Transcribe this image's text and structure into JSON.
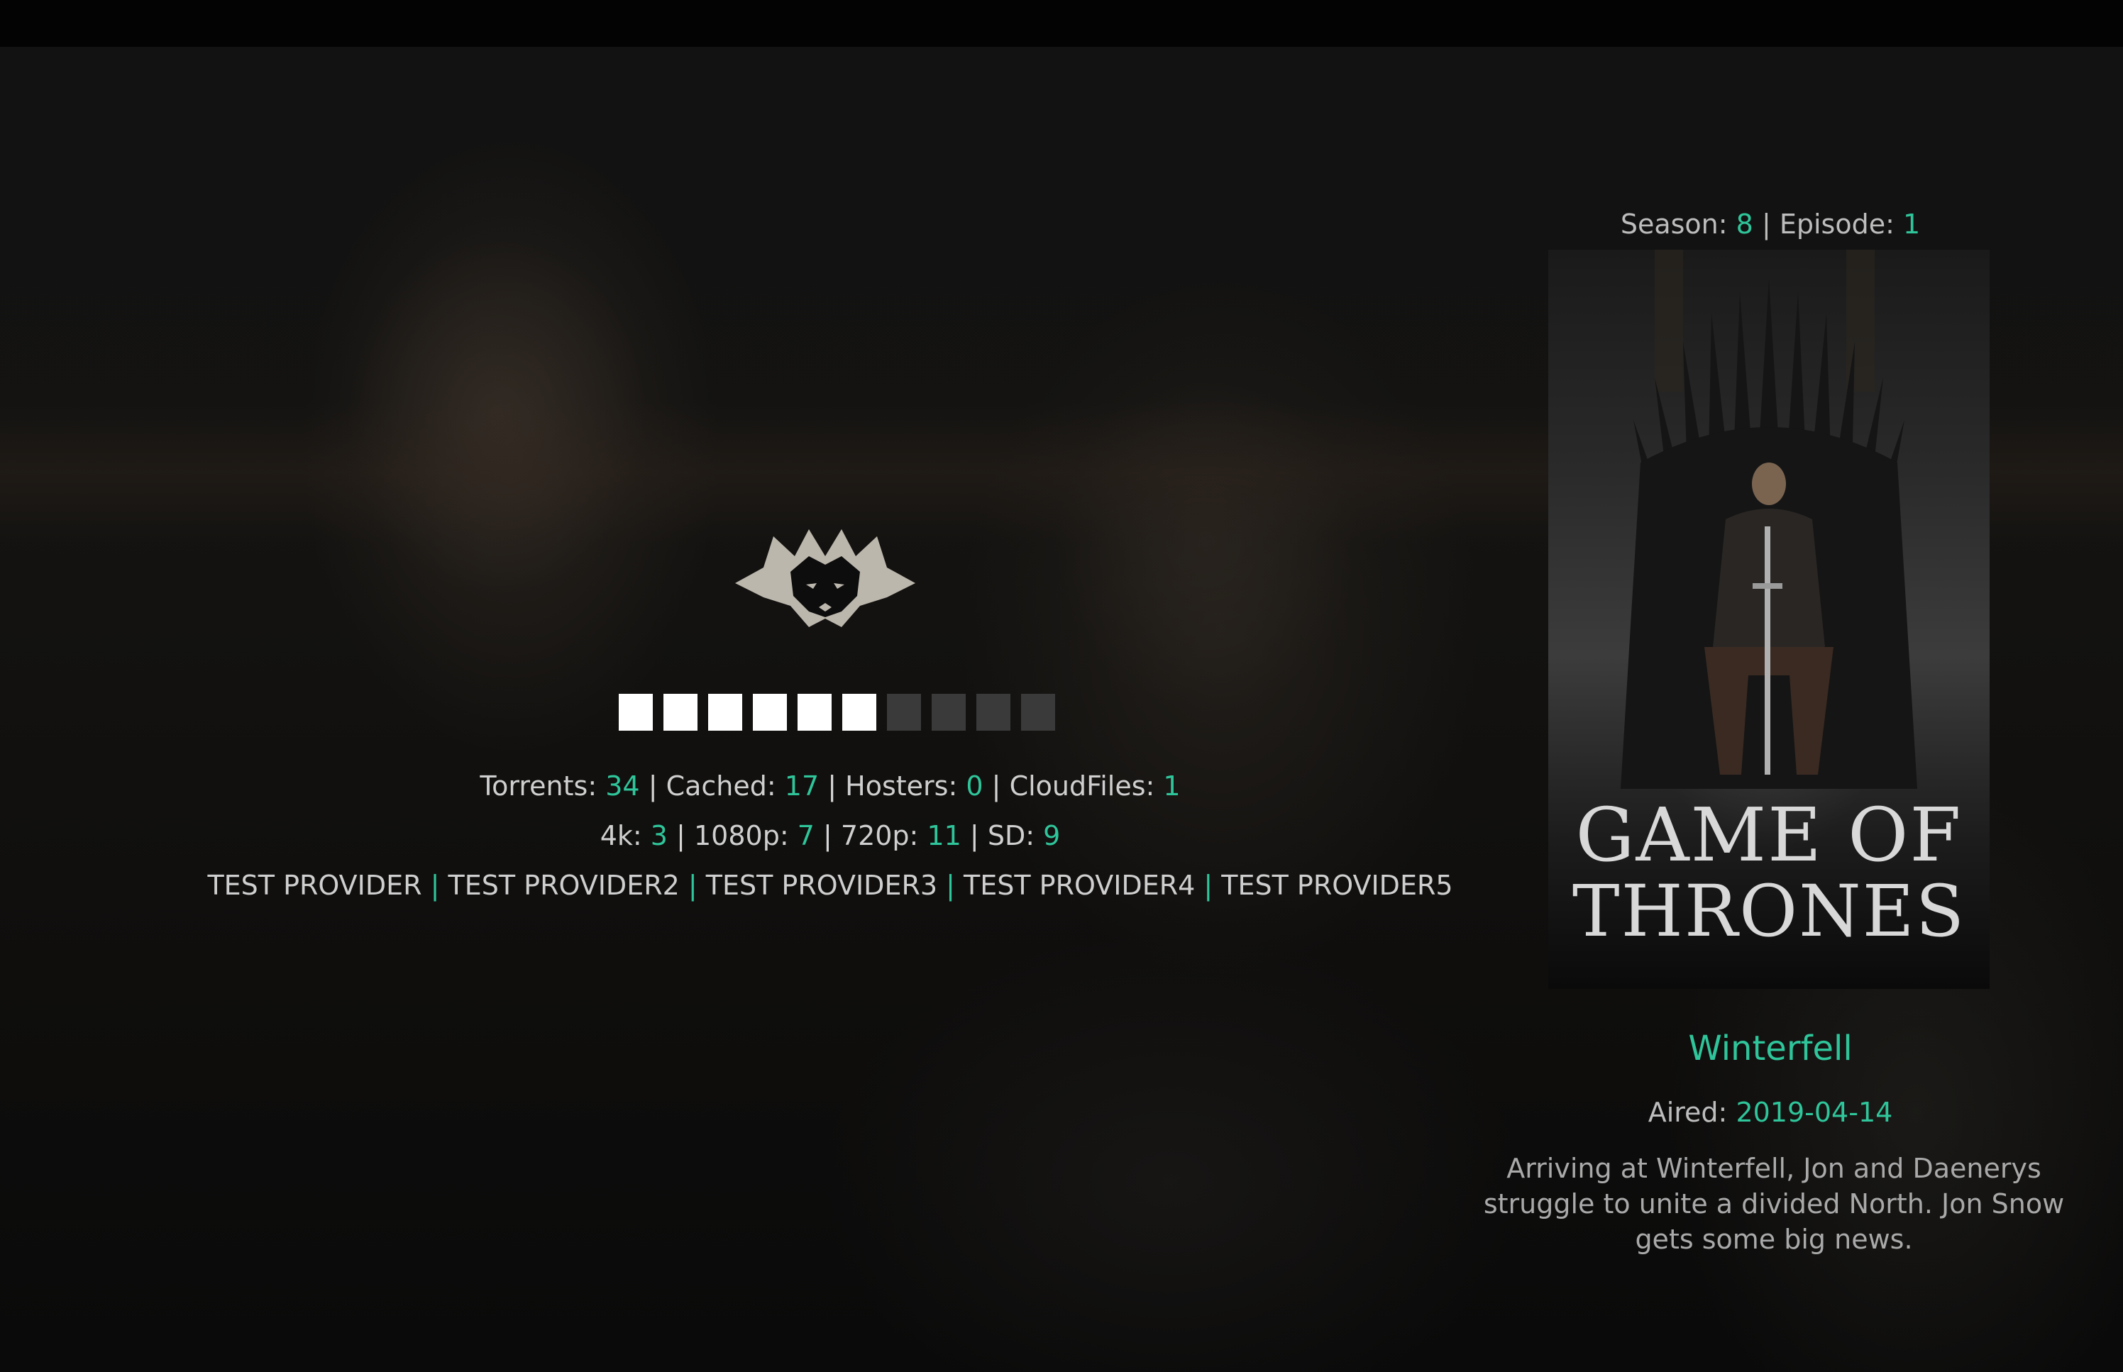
{
  "stats": {
    "torrents_label": "Torrents:",
    "torrents": "34",
    "cached_label": "Cached:",
    "cached": "17",
    "hosters_label": "Hosters:",
    "hosters": "0",
    "cloudfiles_label": "CloudFiles:",
    "cloudfiles": "1",
    "sep": "|"
  },
  "quality": {
    "q4k_label": "4k:",
    "q4k": "3",
    "q1080_label": "1080p:",
    "q1080": "7",
    "q720_label": "720p:",
    "q720": "11",
    "sd_label": "SD:",
    "sd": "9"
  },
  "providers": [
    "TEST PROVIDER",
    "TEST PROVIDER2",
    "TEST PROVIDER3",
    "TEST PROVIDER4",
    "TEST PROVIDER5"
  ],
  "progress": {
    "filled": 6,
    "total": 10,
    "fraction": 0.6
  },
  "episode_info": {
    "season_label": "Season:",
    "season": "8",
    "episode_label": "| Episode:",
    "episode": "1"
  },
  "poster": {
    "title_line1": "GAME OF",
    "title_line2": "THRONES"
  },
  "episode": {
    "title": "Winterfell",
    "aired_label": "Aired:",
    "aired": "2019-04-14",
    "plot": "Arriving at Winterfell, Jon and Daenerys struggle to unite a divided North. Jon Snow gets some big news."
  },
  "colors": {
    "accent": "#2fc59a",
    "text": "#cfcfcf",
    "progress_filled": "#ffffff",
    "progress_empty": "#3a3a3a"
  },
  "icons": {
    "logo": "wolf-logo-icon"
  }
}
